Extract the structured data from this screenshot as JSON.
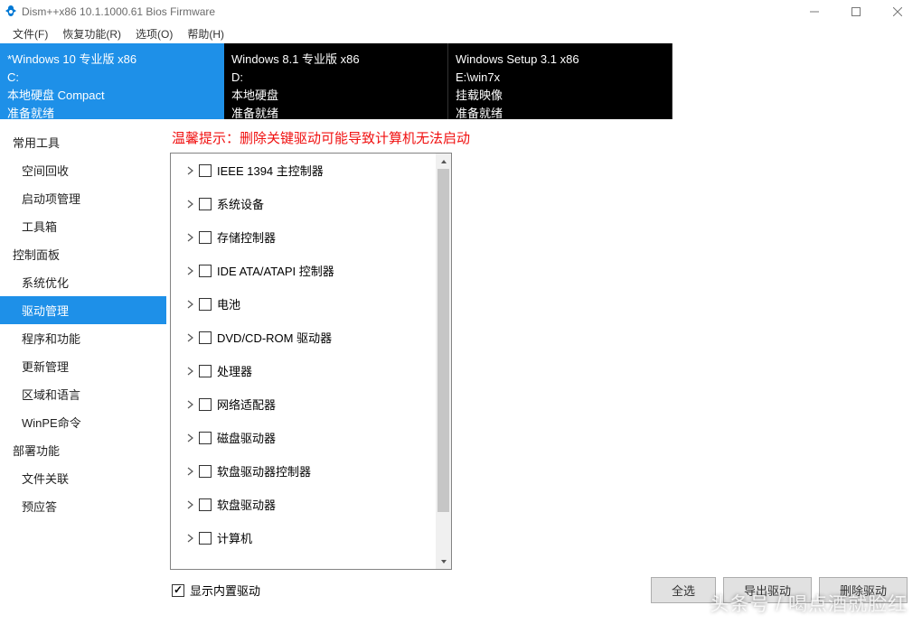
{
  "title": "Dism++x86 10.1.1000.61 Bios Firmware",
  "menubar": [
    "文件(F)",
    "恢复功能(R)",
    "选项(O)",
    "帮助(H)"
  ],
  "tabs": [
    {
      "title": "*Windows 10 专业版 x86",
      "drive": "C:",
      "disk": "本地硬盘 Compact",
      "status": "准备就绪",
      "active": true
    },
    {
      "title": "Windows 8.1 专业版 x86",
      "drive": "D:",
      "disk": "本地硬盘",
      "status": "准备就绪",
      "active": false
    },
    {
      "title": "Windows Setup 3.1 x86",
      "drive": "E:\\win7x",
      "disk": "挂载映像",
      "status": "准备就绪",
      "active": false
    }
  ],
  "sidebar": [
    {
      "type": "cat",
      "label": "常用工具"
    },
    {
      "type": "item",
      "label": "空间回收"
    },
    {
      "type": "item",
      "label": "启动项管理"
    },
    {
      "type": "item",
      "label": "工具箱"
    },
    {
      "type": "cat",
      "label": "控制面板"
    },
    {
      "type": "item",
      "label": "系统优化"
    },
    {
      "type": "item",
      "label": "驱动管理",
      "selected": true
    },
    {
      "type": "item",
      "label": "程序和功能"
    },
    {
      "type": "item",
      "label": "更新管理"
    },
    {
      "type": "item",
      "label": "区域和语言"
    },
    {
      "type": "item",
      "label": "WinPE命令"
    },
    {
      "type": "cat",
      "label": "部署功能"
    },
    {
      "type": "item",
      "label": "文件关联"
    },
    {
      "type": "item",
      "label": "预应答"
    }
  ],
  "warning": "温馨提示：删除关键驱动可能导致计算机无法启动",
  "tree": [
    "IEEE 1394 主控制器",
    "系统设备",
    "存储控制器",
    "IDE ATA/ATAPI 控制器",
    "电池",
    "DVD/CD-ROM 驱动器",
    "处理器",
    "网络适配器",
    "磁盘驱动器",
    "软盘驱动器控制器",
    "软盘驱动器",
    "计算机"
  ],
  "show_builtin": "显示内置驱动",
  "buttons": {
    "select_all": "全选",
    "export": "导出驱动",
    "delete": "删除驱动"
  },
  "watermark": "头条号 / 喝点酒就脸红"
}
